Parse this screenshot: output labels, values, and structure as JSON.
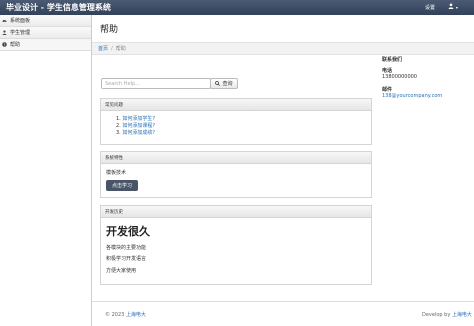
{
  "topbar": {
    "brand": "毕业设计 - 学生信息管理系统",
    "settings": "设置",
    "user_caret": "▾"
  },
  "sidebar": {
    "items": [
      {
        "label": "系统面板",
        "icon": "dashboard-icon"
      },
      {
        "label": "学生管理",
        "icon": "user-icon"
      },
      {
        "label": "帮助",
        "icon": "help-icon"
      }
    ]
  },
  "main": {
    "title": "帮助",
    "breadcrumb": {
      "home": "首页",
      "sep": "/",
      "current": "帮助"
    },
    "search": {
      "placeholder": "Search Help...",
      "button": "查询"
    },
    "faq": {
      "title": "常见问题",
      "items": [
        {
          "num": "1.",
          "text": "如何添加学生?"
        },
        {
          "num": "2.",
          "text": "如何添加课程?"
        },
        {
          "num": "3.",
          "text": "如何添加成绩?"
        }
      ]
    },
    "features": {
      "title": "系统特性",
      "text": "模板技术",
      "button": "点击学习"
    },
    "dev": {
      "title": "开发历史",
      "heading": "开发很久",
      "lines": [
        "各模块的主要功能",
        "积极学习开发语言",
        "方便大家使用"
      ]
    },
    "contact": {
      "title": "联系我们",
      "phone_label": "电话",
      "phone": "13800000000",
      "email_label": "邮件",
      "email": "138@yourcompany.com"
    },
    "footer": {
      "copyright": "© 2023",
      "copyright_link": "上海电大",
      "develop": "Develop by",
      "develop_link": "上海电大"
    }
  },
  "colors": {
    "accent": "#2a6fb8",
    "topbar": "#3d4c63",
    "button": "#4a5468"
  }
}
